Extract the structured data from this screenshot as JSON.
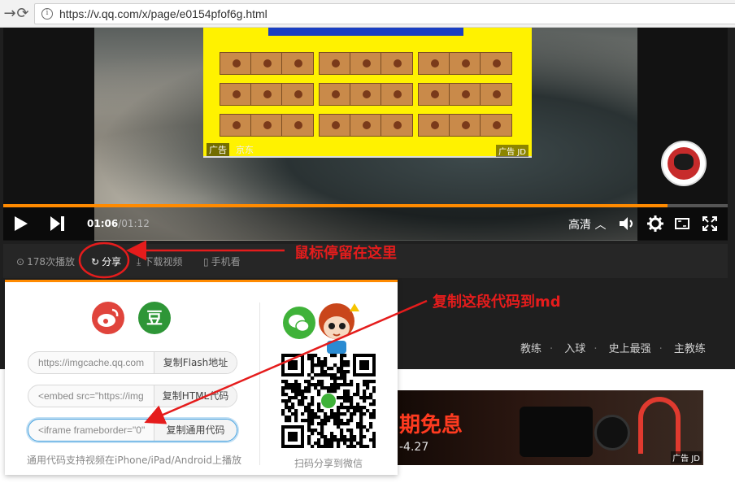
{
  "browser": {
    "url": "https://v.qq.com/x/page/e0154pfof6g.html"
  },
  "player": {
    "current_time": "01:06",
    "separator": "/",
    "total_time": "01:12",
    "progress_fraction": 0.917,
    "quality_label": "高清",
    "ad": {
      "badge": "广告",
      "advertiser": "京东",
      "corner_tag": "广告 JD"
    }
  },
  "actions": {
    "play_count": "178次播放",
    "share": "分享",
    "download": "下载视频",
    "mobile": "手机看"
  },
  "share_panel": {
    "social": {
      "weibo_glyph": "",
      "douban_glyph": "豆"
    },
    "rows": [
      {
        "value": "https://imgcache.qq.com",
        "copy_label": "复制Flash地址"
      },
      {
        "value": "<embed src=\"https://img",
        "copy_label": "复制HTML代码"
      },
      {
        "value": "<iframe frameborder=\"0\"",
        "copy_label": "复制通用代码"
      }
    ],
    "note": "通用代码支持视频在iPhone/iPad/Android上播放",
    "scan_text": "扫码分享到微信"
  },
  "page_tags": [
    "教练",
    "入球",
    "史上最强",
    "主教练"
  ],
  "banner": {
    "headline": "期免息",
    "date": "-4.27",
    "ad_tag": "广告 JD"
  },
  "annotations": {
    "hover_note": "鼠标停留在这里",
    "copy_note": "复制这段代码到md"
  },
  "colors": {
    "accent": "#ff8a00",
    "annotation": "#e51c1c",
    "highlight": "#4aa3df"
  }
}
